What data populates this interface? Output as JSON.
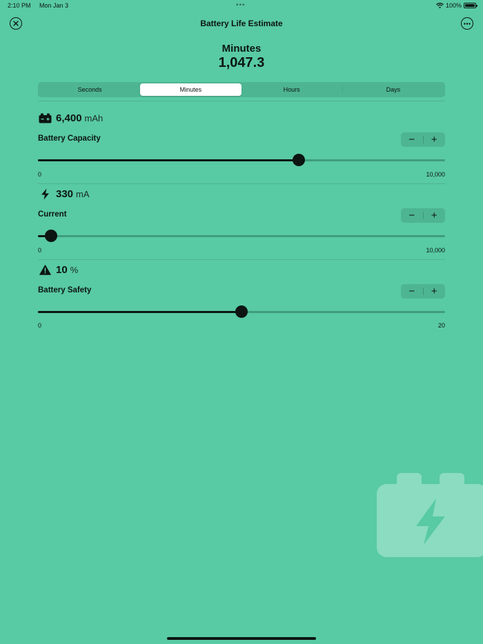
{
  "status_bar": {
    "time": "2:10 PM",
    "date": "Mon Jan 3",
    "battery": "100%"
  },
  "nav": {
    "title": "Battery Life Estimate"
  },
  "result": {
    "label": "Minutes",
    "value": "1,047.3"
  },
  "units_tabs": [
    {
      "label": "Seconds",
      "active": false
    },
    {
      "label": "Minutes",
      "active": true
    },
    {
      "label": "Hours",
      "active": false
    },
    {
      "label": "Days",
      "active": false
    }
  ],
  "params": [
    {
      "icon": "car-battery-icon",
      "value": "6,400",
      "unit": "mAh",
      "label": "Battery Capacity",
      "min": "0",
      "max": "10,000",
      "slider_value": 6400,
      "slider_min": 0,
      "slider_max": 10000
    },
    {
      "icon": "lightning-bolt-icon",
      "value": "330",
      "unit": "mA",
      "label": "Current",
      "min": "0",
      "max": "10,000",
      "slider_value": 330,
      "slider_min": 0,
      "slider_max": 10000
    },
    {
      "icon": "warning-triangle-icon",
      "value": "10",
      "unit": "%",
      "label": "Battery Safety",
      "min": "0",
      "max": "20",
      "slider_value": 10,
      "slider_min": 0,
      "slider_max": 20
    }
  ],
  "stepper": {
    "minus": "−",
    "plus": "+"
  },
  "colors": {
    "background": "#58caa4",
    "accent_dark": "#0c1512",
    "track": "#3f9d7d",
    "segment_bg": "#4eb592"
  }
}
